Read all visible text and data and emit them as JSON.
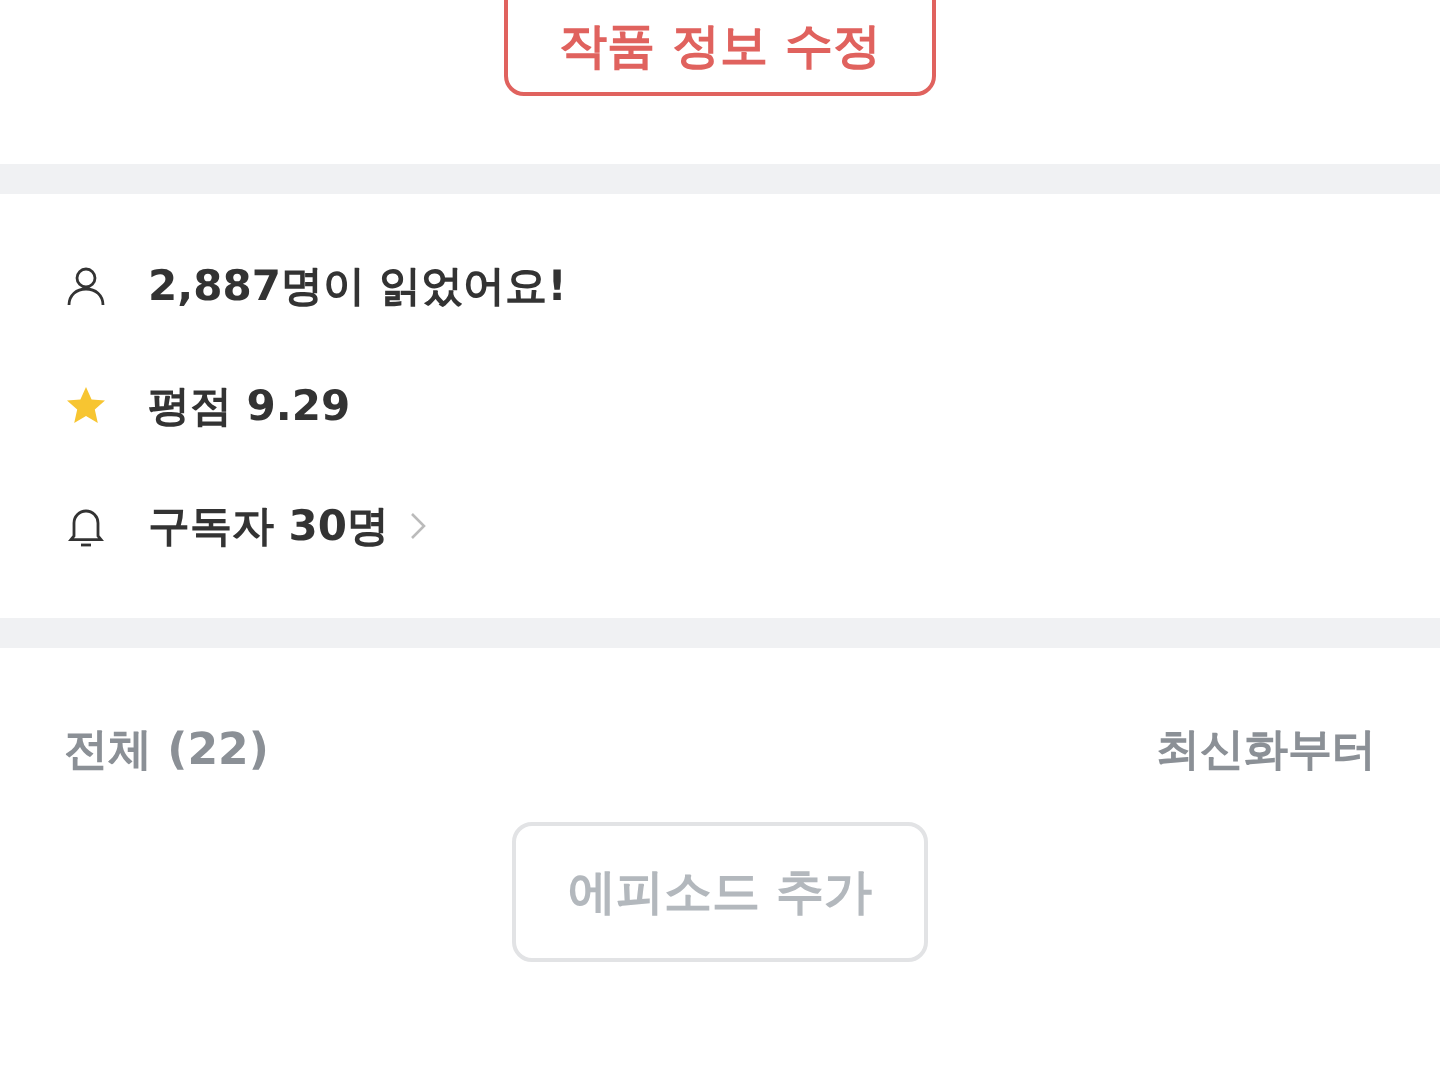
{
  "edit_button": {
    "label": "작품 정보 수정"
  },
  "stats": [
    {
      "kind": "readers",
      "text": "2,887명이 읽었어요!"
    },
    {
      "kind": "rating",
      "text": "평점 9.29"
    },
    {
      "kind": "subscribers",
      "text": "구독자 30명"
    }
  ],
  "episodes": {
    "count_label": "전체 (22)",
    "sort_label": "최신화부터",
    "add_button": {
      "label": "에피소드 추가",
      "disabled": true
    }
  }
}
